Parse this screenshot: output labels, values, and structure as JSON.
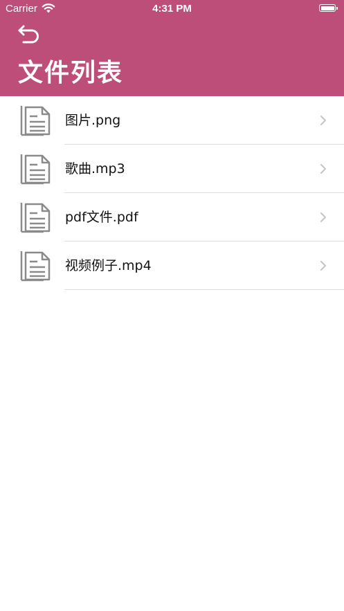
{
  "status_bar": {
    "carrier": "Carrier",
    "time": "4:31 PM",
    "icons": [
      "wifi-icon",
      "battery-icon"
    ]
  },
  "header": {
    "back_icon": "back-arrow-icon",
    "title": "文件列表",
    "background_color": "#bd4d79"
  },
  "files": [
    {
      "name": "图片.png",
      "icon": "document-icon"
    },
    {
      "name": "歌曲.mp3",
      "icon": "document-icon"
    },
    {
      "name": "pdf文件.pdf",
      "icon": "document-icon"
    },
    {
      "name": "视频例子.mp4",
      "icon": "document-icon"
    }
  ],
  "row_accessory": "chevron-right-icon"
}
